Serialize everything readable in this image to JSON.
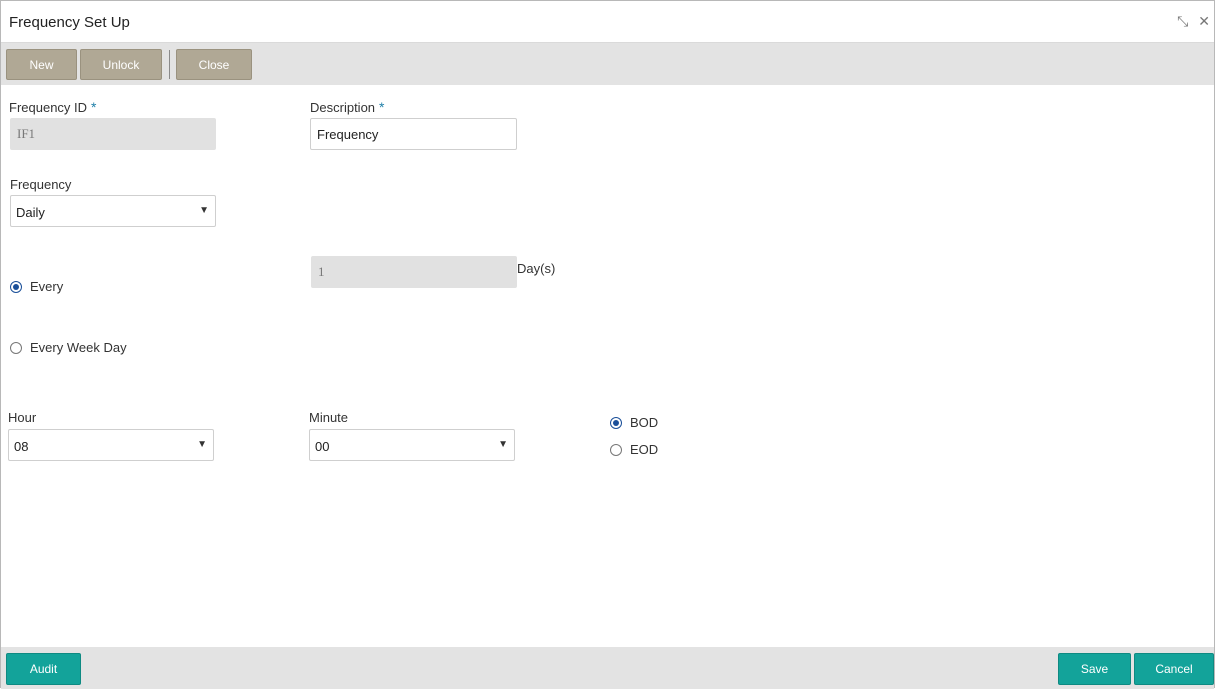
{
  "window": {
    "title": "Frequency Set Up",
    "minimize_icon": "collapse-icon",
    "close_icon": "close-icon",
    "minimize_glyph": "⤡",
    "close_glyph": "✕"
  },
  "toolbar": {
    "new_label": "New",
    "unlock_label": "Unlock",
    "close_label": "Close"
  },
  "form": {
    "frequency_id": {
      "label": "Frequency ID",
      "required": "*",
      "value": "IF1"
    },
    "description": {
      "label": "Description",
      "required": "*",
      "value": "Frequency"
    },
    "frequency": {
      "label": "Frequency",
      "selected": "Daily"
    },
    "every": {
      "label": "Every",
      "value": "1",
      "unit": "Day(s)",
      "checked": true
    },
    "every_week_day": {
      "label": "Every Week Day",
      "checked": false
    },
    "hour": {
      "label": "Hour",
      "selected": "08"
    },
    "minute": {
      "label": "Minute",
      "selected": "00"
    },
    "bod": {
      "label": "BOD",
      "checked": true
    },
    "eod": {
      "label": "EOD",
      "checked": false
    }
  },
  "footer": {
    "audit_label": "Audit",
    "save_label": "Save",
    "cancel_label": "Cancel"
  },
  "colors": {
    "toolbar_button": "#b0a895",
    "footer_button": "#13a39a",
    "radio_selected": "#1a4f99",
    "required_star": "#1f7fa8"
  }
}
